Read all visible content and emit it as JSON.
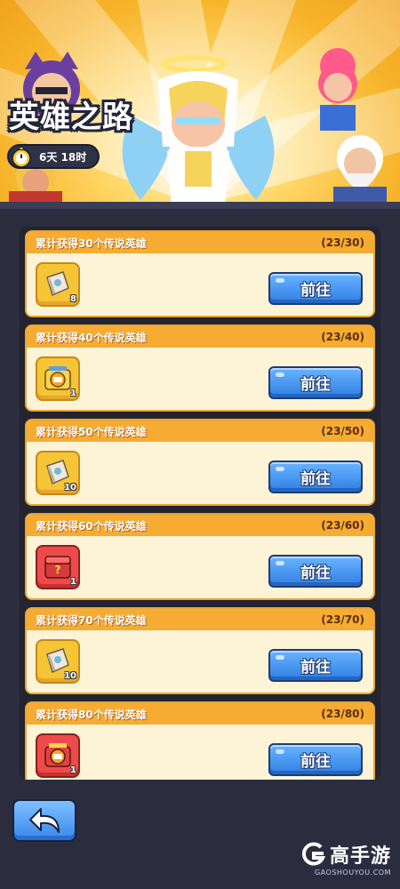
{
  "banner": {
    "title": "英雄之路",
    "timer": "6天 18时"
  },
  "tasks": [
    {
      "label": "累计获得30个传说英雄",
      "progress": "(23/30)",
      "reward_icon": "scroll-icon",
      "reward_qty": "8",
      "button": "前往"
    },
    {
      "label": "累计获得40个传说英雄",
      "progress": "(23/40)",
      "reward_icon": "legend-chest-icon",
      "reward_qty": "1",
      "button": "前往"
    },
    {
      "label": "累计获得50个传说英雄",
      "progress": "(23/50)",
      "reward_icon": "scroll-icon",
      "reward_qty": "10",
      "button": "前往"
    },
    {
      "label": "累计获得60个传说英雄",
      "progress": "(23/60)",
      "reward_icon": "mystery-chest-icon",
      "reward_qty": "1",
      "button": "前往"
    },
    {
      "label": "累计获得70个传说英雄",
      "progress": "(23/70)",
      "reward_icon": "scroll-icon",
      "reward_qty": "10",
      "button": "前往"
    },
    {
      "label": "累计获得80个传说英雄",
      "progress": "(23/80)",
      "reward_icon": "red-chest-icon",
      "reward_qty": "1",
      "button": "前往"
    }
  ],
  "watermark": {
    "text": "高手游",
    "sub": "GAOSHOUYOU.COM"
  },
  "colors": {
    "card_header": "#f6ab33",
    "button_blue": "#3a87ec",
    "background": "#2b2d3f"
  }
}
